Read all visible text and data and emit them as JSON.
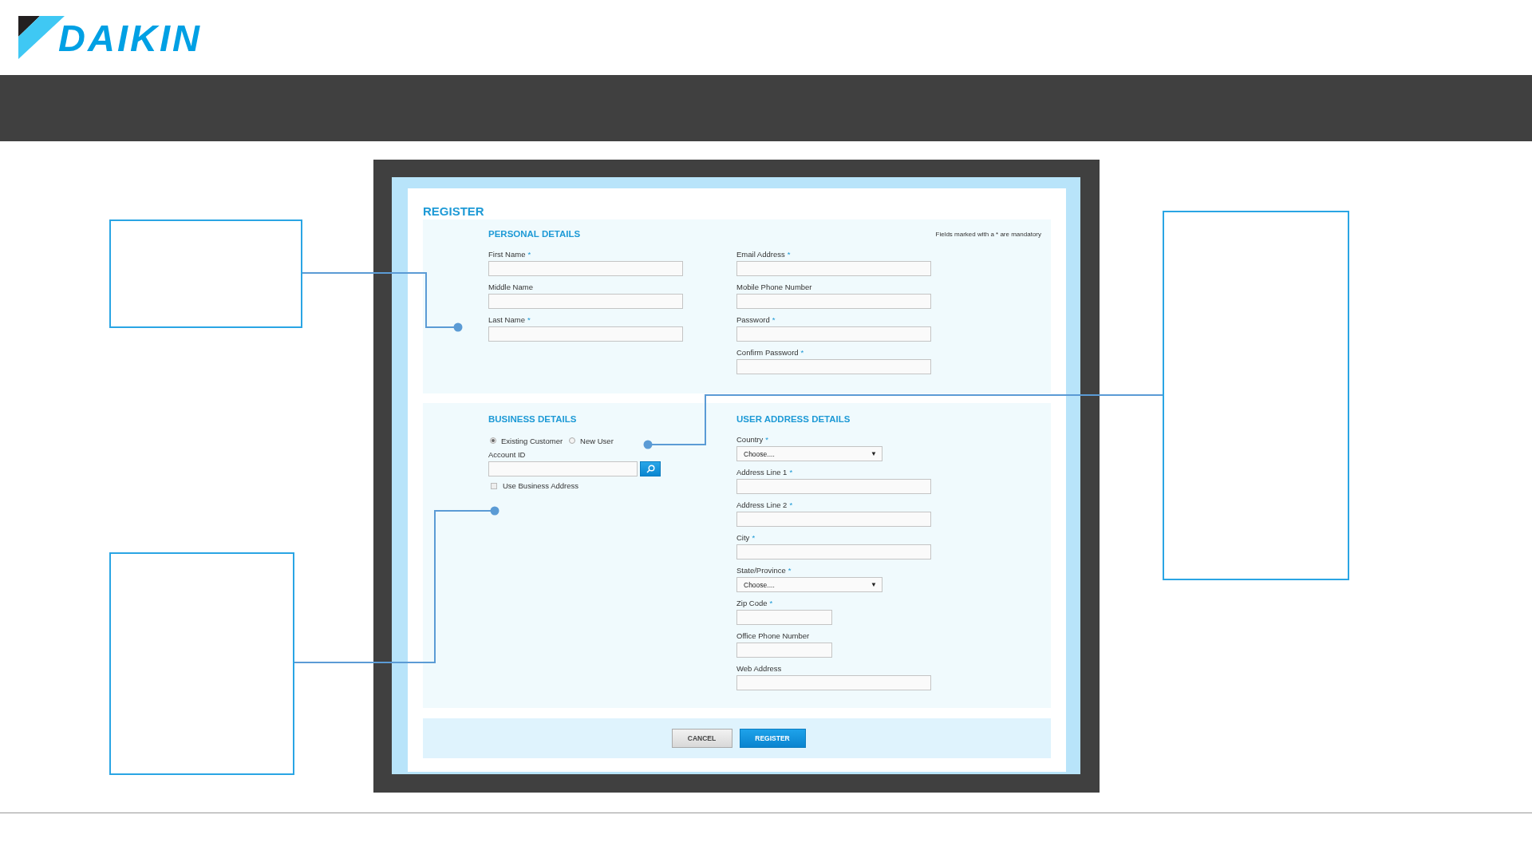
{
  "logo": {
    "text": "DAIKIN"
  },
  "form": {
    "title": "REGISTER",
    "sections": [
      {
        "title": "PERSONAL DETAILS",
        "note": "Fields marked with a * are mandatory",
        "columns": [
          {
            "items": [
              {
                "kind": "text",
                "label": "First Name",
                "required_mark": "*"
              },
              {
                "kind": "text",
                "label": "Middle Name"
              },
              {
                "kind": "text",
                "label": "Last Name",
                "required_mark": "*"
              }
            ]
          },
          {
            "items": [
              {
                "kind": "text",
                "label": "Email Address",
                "required_mark": "*"
              },
              {
                "kind": "text",
                "label": "Mobile Phone Number"
              },
              {
                "kind": "text",
                "label": "Password",
                "required_mark": "*"
              },
              {
                "kind": "text",
                "label": "Confirm Password",
                "required_mark": "*"
              }
            ]
          }
        ]
      },
      {
        "columns": [
          {
            "title": "BUSINESS DETAILS",
            "items": [
              {
                "kind": "radios",
                "options": [
                  {
                    "label": "Existing Customer",
                    "selected": true
                  },
                  {
                    "label": "New User",
                    "selected": false
                  }
                ]
              },
              {
                "kind": "search",
                "label": "Account ID"
              },
              {
                "kind": "checkbox",
                "label": "Use Business Address",
                "checked": false
              }
            ]
          },
          {
            "title": "USER ADDRESS DETAILS",
            "items": [
              {
                "kind": "select",
                "label": "Country",
                "required_mark": "*",
                "value": "Choose....",
                "caret": "▼"
              },
              {
                "kind": "text",
                "label": "Address Line 1",
                "required_mark": "*"
              },
              {
                "kind": "text",
                "label": "Address Line 2",
                "required_mark": "*"
              },
              {
                "kind": "text",
                "label": "City",
                "required_mark": "*"
              },
              {
                "kind": "select",
                "label": "State/Province",
                "required_mark": "*",
                "value": "Choose....",
                "caret": "▼"
              },
              {
                "kind": "short-text",
                "label": "Zip Code",
                "required_mark": "*"
              },
              {
                "kind": "short-text",
                "label": "Office Phone Number"
              },
              {
                "kind": "text",
                "label": "Web Address"
              }
            ]
          }
        ]
      }
    ],
    "buttons": [
      {
        "label": "CANCEL",
        "kind": "secondary"
      },
      {
        "label": "REGISTER",
        "kind": "primary"
      }
    ]
  }
}
